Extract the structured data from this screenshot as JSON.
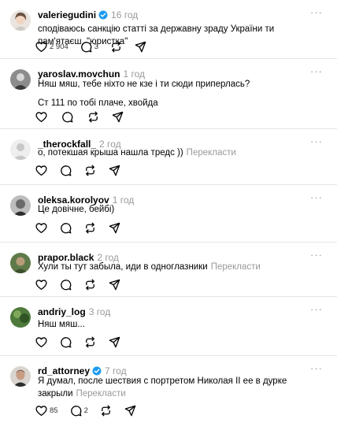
{
  "posts": [
    {
      "username": "valeriegudini",
      "verified": true,
      "time": "16 год",
      "lines": [
        "сподіваюсь санкцію статті за державну зраду України ти пам'ятаєш, \"юристка\""
      ],
      "translate": "",
      "likes": "2 904",
      "comments": "3"
    },
    {
      "username": "yaroslav.movchun",
      "verified": false,
      "time": "1 год",
      "lines": [
        "Няш мяш, тебе ніхто не кзе і ти сюди приперлась?",
        "Ст 111 по тобі плаче, хвойда"
      ],
      "translate": "",
      "likes": "",
      "comments": ""
    },
    {
      "username": "_therockfall_",
      "verified": false,
      "time": "2 год",
      "lines": [
        "о, потекшая крыша нашла тредс ))"
      ],
      "translate": "Перекласти",
      "likes": "",
      "comments": ""
    },
    {
      "username": "oleksa.korolyov",
      "verified": false,
      "time": "1 год",
      "lines": [
        "Це довічне, бейбі)"
      ],
      "translate": "",
      "likes": "",
      "comments": ""
    },
    {
      "username": "prapor.black",
      "verified": false,
      "time": "2 год",
      "lines": [
        "Хули ты тут забыла, иди в одноглазники"
      ],
      "translate": "Перекласти",
      "likes": "",
      "comments": ""
    },
    {
      "username": "andriy_log",
      "verified": false,
      "time": "3 год",
      "lines": [
        "Няш мяш..."
      ],
      "translate": "",
      "likes": "",
      "comments": ""
    },
    {
      "username": "rd_attorney",
      "verified": true,
      "time": "7 год",
      "lines": [
        "Я думал, после шествия с портретом Николая II ее в дурке",
        "закрыли"
      ],
      "translate": "Перекласти",
      "likes": "85",
      "comments": "2"
    }
  ],
  "menu_glyph": "···",
  "colors": {
    "verified": "#1d9bf0",
    "muted": "#999999",
    "divider": "#e5e5e5"
  },
  "icons": {
    "like": "heart-icon",
    "comment": "comment-icon",
    "repost": "repost-icon",
    "share": "share-icon",
    "more": "more-icon",
    "verified": "verified-badge-icon"
  }
}
